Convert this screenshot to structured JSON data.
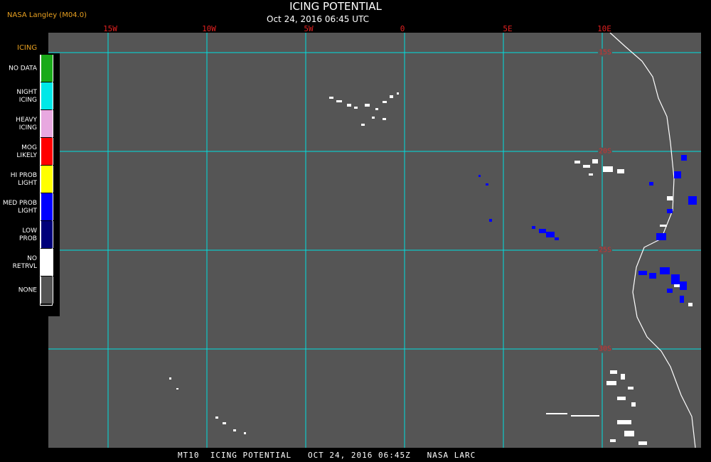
{
  "credit": "NASA Langley (M04.0)",
  "title": "ICING POTENTIAL",
  "subtitle": "Oct 24, 2016 06:45 UTC",
  "footer": "MT10  ICING POTENTIAL   OCT 24, 2016 06:45Z   NASA LARC",
  "legend": {
    "title": "ICING",
    "items": [
      {
        "label": "NO DATA",
        "color": "#1aaa1a"
      },
      {
        "label": "NIGHT\nICING",
        "color": "#00e8e8"
      },
      {
        "label": "HEAVY\nICING",
        "color": "#e8a8e0"
      },
      {
        "label": "MOG\nLIKELY",
        "color": "#ff0000"
      },
      {
        "label": "HI PROB\nLIGHT",
        "color": "#ffff00"
      },
      {
        "label": "MED PROB\nLIGHT",
        "color": "#0000ff"
      },
      {
        "label": "LOW\nPROB",
        "color": "#00007a"
      },
      {
        "label": "NO\nRETRVL",
        "color": "#ffffff"
      },
      {
        "label": "NONE",
        "color": "#555555"
      }
    ]
  },
  "grid": {
    "color": "#00e0e0",
    "longitudes": [
      "15W",
      "10W",
      "5W",
      "0",
      "5E",
      "10E"
    ],
    "latitudes": [
      "15S",
      "20S",
      "25S",
      "30S"
    ]
  }
}
